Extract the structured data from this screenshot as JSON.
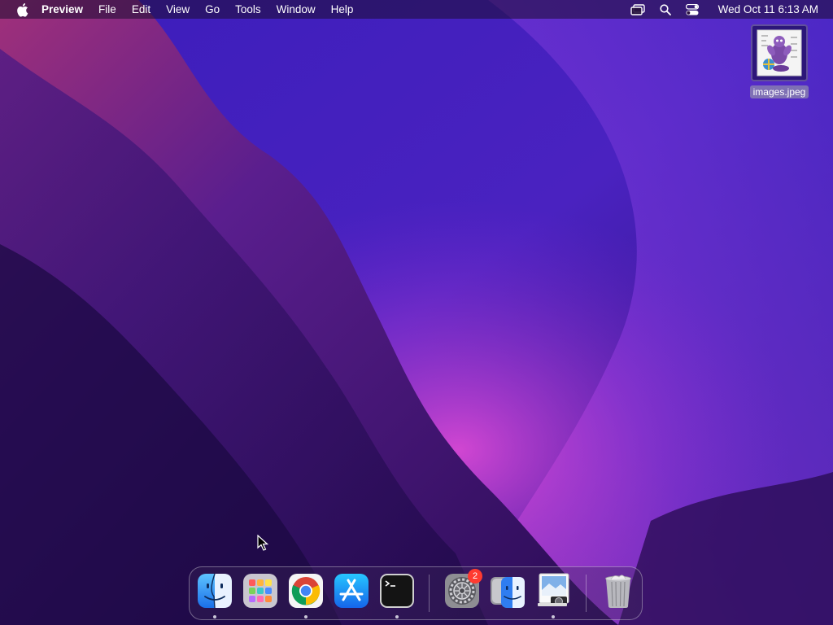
{
  "menubar": {
    "app_name": "Preview",
    "menus": [
      "File",
      "Edit",
      "View",
      "Go",
      "Tools",
      "Window",
      "Help"
    ],
    "clock": "Wed Oct 11  6:13 AM",
    "status_icons": [
      "screen-mirroring-icon",
      "spotlight-search-icon",
      "control-center-icon"
    ]
  },
  "desktop": {
    "file": {
      "label": "images.jpeg",
      "icon": "image-file-icon"
    }
  },
  "dock": {
    "items": [
      {
        "name": "Finder",
        "icon": "finder-icon",
        "running": true
      },
      {
        "name": "Launchpad",
        "icon": "launchpad-icon",
        "running": false
      },
      {
        "name": "Google Chrome",
        "icon": "chrome-icon",
        "running": true
      },
      {
        "name": "App Store",
        "icon": "app-store-icon",
        "running": false
      },
      {
        "name": "Terminal",
        "icon": "terminal-icon",
        "running": true
      },
      {
        "name": "System Preferences",
        "icon": "system-preferences-icon",
        "badge": "2",
        "running": false
      },
      {
        "name": "Migration Assistant",
        "icon": "migration-assistant-icon",
        "running": false
      },
      {
        "name": "Preview",
        "icon": "preview-icon",
        "running": true
      },
      {
        "name": "Trash",
        "icon": "trash-icon",
        "running": false
      }
    ]
  },
  "colors": {
    "wallpaper_dark": "#1e0a5c",
    "wallpaper_magenta": "#b02a9a",
    "badge_red": "#ff3b30"
  }
}
